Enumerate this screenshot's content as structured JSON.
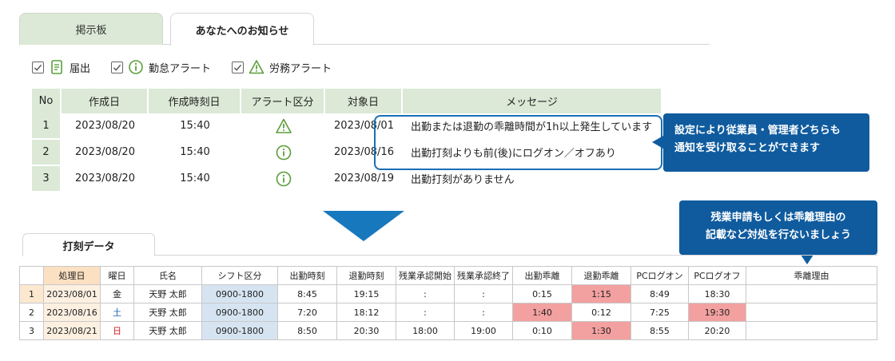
{
  "tabs": {
    "board": "掲示板",
    "notices": "あなたへのお知らせ"
  },
  "filters": [
    {
      "label": "届出",
      "icon": "document-icon",
      "checked": true
    },
    {
      "label": "勤怠アラート",
      "icon": "info-circle-icon",
      "checked": true
    },
    {
      "label": "労務アラート",
      "icon": "warning-triangle-icon",
      "checked": true
    }
  ],
  "notifications": {
    "headers": [
      "No",
      "作成日",
      "作成時刻日",
      "アラート区分",
      "対象日",
      "メッセージ"
    ],
    "rows": [
      {
        "no": "1",
        "date": "2023/08/20",
        "time": "15:40",
        "alert_type": "warning-triangle-icon",
        "target": "2023/08/01",
        "message": "出勤または退勤の乖離時間が1h以上発生しています"
      },
      {
        "no": "2",
        "date": "2023/08/20",
        "time": "15:40",
        "alert_type": "info-circle-icon",
        "target": "2023/08/16",
        "message": "出勤打刻よりも前(後)にログオン／オフあり"
      },
      {
        "no": "3",
        "date": "2023/08/20",
        "time": "15:40",
        "alert_type": "info-circle-icon",
        "target": "2023/08/19",
        "message": "出勤打刻がありません"
      }
    ]
  },
  "callouts": {
    "notify": [
      "設定により従業員・管理者どちらも",
      "通知を受け取ることができます"
    ],
    "reason": [
      "残業申請もしくは乖離理由の",
      "記載など対処を行ないましょう"
    ]
  },
  "punch_tab": "打刻データ",
  "punch": {
    "headers": [
      "",
      "処理日",
      "曜日",
      "氏名",
      "シフト区分",
      "出勤時刻",
      "退勤時刻",
      "残業承認開始",
      "残業承認終了",
      "出勤乖離",
      "退勤乖離",
      "PCログオン",
      "PCログオフ",
      "乖離理由"
    ],
    "rows": [
      {
        "n": "1",
        "date": "2023/08/01",
        "dow": "金",
        "name": "天野 太郎",
        "shift": "0900-1800",
        "in": "8:45",
        "out": "19:15",
        "ot_start": ":",
        "ot_end": ":",
        "in_gap": "0:15",
        "out_gap": "1:15",
        "pc_on": "8:49",
        "pc_off": "18:30",
        "reason": ""
      },
      {
        "n": "2",
        "date": "2023/08/16",
        "dow": "土",
        "name": "天野 太郎",
        "shift": "0900-1800",
        "in": "7:20",
        "out": "18:12",
        "ot_start": ":",
        "ot_end": ":",
        "in_gap": "1:40",
        "out_gap": "0:12",
        "pc_on": "7:25",
        "pc_off": "19:30",
        "reason": ""
      },
      {
        "n": "3",
        "date": "2023/08/21",
        "dow": "日",
        "name": "天野 太郎",
        "shift": "0900-1800",
        "in": "8:50",
        "out": "20:30",
        "ot_start": "18:00",
        "ot_end": "19:00",
        "in_gap": "0:10",
        "out_gap": "1:30",
        "pc_on": "8:55",
        "pc_off": "20:20",
        "reason": ""
      }
    ]
  },
  "colors": {
    "green_header": "#dbe9d6",
    "callout_blue": "#0f5b9e",
    "alert_red": "#f3a0a0",
    "icon_green": "#5a9e3a"
  }
}
